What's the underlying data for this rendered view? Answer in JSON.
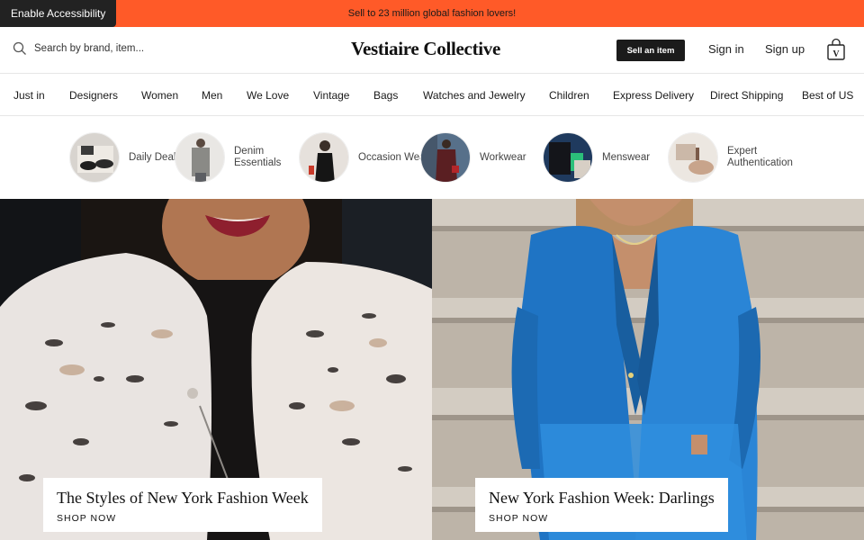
{
  "banner": {
    "accessibility_label": "Enable Accessibility",
    "promo_text": "Sell to 23 million global fashion lovers!",
    "background_color": "#ff5a28"
  },
  "header": {
    "search_placeholder": "Search by brand, item...",
    "logo_text": "Vestiaire Collective",
    "sell_label": "Sell an item",
    "signin_label": "Sign in",
    "signup_label": "Sign up",
    "bag_icon_letter": "V"
  },
  "nav": {
    "items": [
      "Just in",
      "Designers",
      "Women",
      "Men",
      "We Love",
      "Vintage",
      "Bags",
      "Watches and Jewelry",
      "Children",
      "Express Delivery",
      "Direct Shipping",
      "Best of US"
    ]
  },
  "categories": [
    {
      "label": "Daily Deals",
      "icon": "shoes-image"
    },
    {
      "label": "Denim Essentials",
      "icon": "denim-jacket-image"
    },
    {
      "label": "Occasion Wear",
      "icon": "black-dress-image"
    },
    {
      "label": "Workwear",
      "icon": "coat-and-bag-image"
    },
    {
      "label": "Menswear",
      "icon": "menswear-image"
    },
    {
      "label": "Expert Authentication",
      "icon": "authentication-image"
    }
  ],
  "heroes": [
    {
      "title": "The Styles of New York Fashion Week",
      "cta": "SHOP NOW",
      "image": "leopard-fur-coat-photo"
    },
    {
      "title": "New York Fashion Week: Darlings",
      "cta": "SHOP NOW",
      "image": "blue-leather-suit-photo"
    }
  ]
}
